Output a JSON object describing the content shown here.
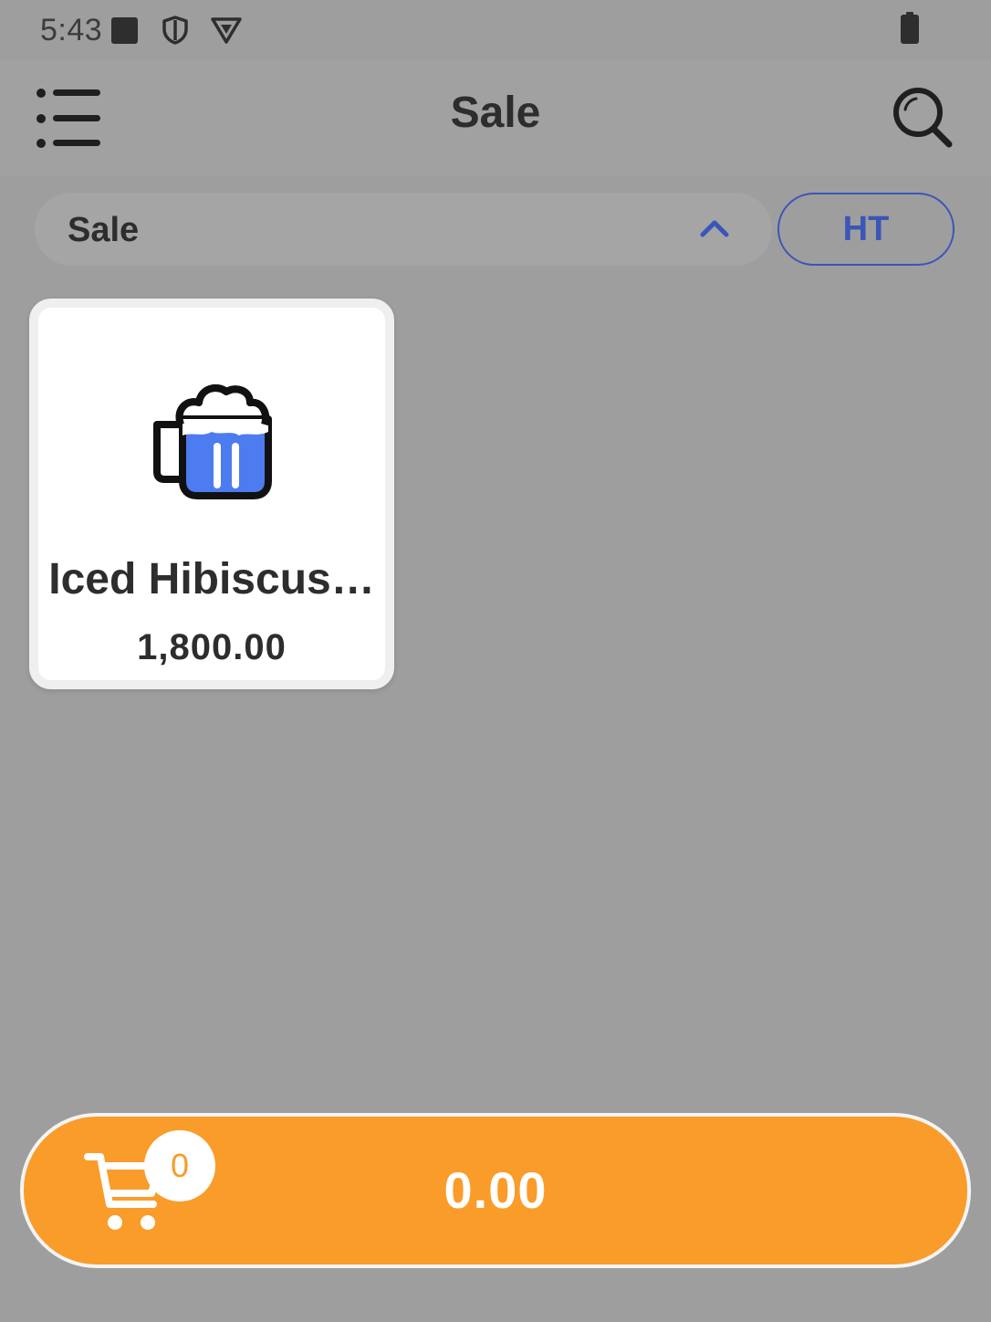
{
  "status_bar": {
    "time": "5:43",
    "icons": [
      "square-notification-icon",
      "shield-icon",
      "vpn-icon",
      "battery-icon"
    ]
  },
  "app_bar": {
    "title": "Sale",
    "menu_icon": "menu-list-icon",
    "search_icon": "search-icon"
  },
  "category_selector": {
    "selected": "Sale",
    "icon": "chevron-up-icon"
  },
  "tax_toggle": {
    "label": "HT"
  },
  "products": [
    {
      "name": "Iced Hibiscus…",
      "price": "1,800.00",
      "icon": "beer-mug-icon"
    }
  ],
  "cart": {
    "count": "0",
    "total": "0.00",
    "icon": "shopping-cart-icon"
  },
  "colors": {
    "accent_blue": "#3b55b8",
    "cart_orange": "#f99c2a",
    "mug_blue": "#4d7cf0"
  }
}
